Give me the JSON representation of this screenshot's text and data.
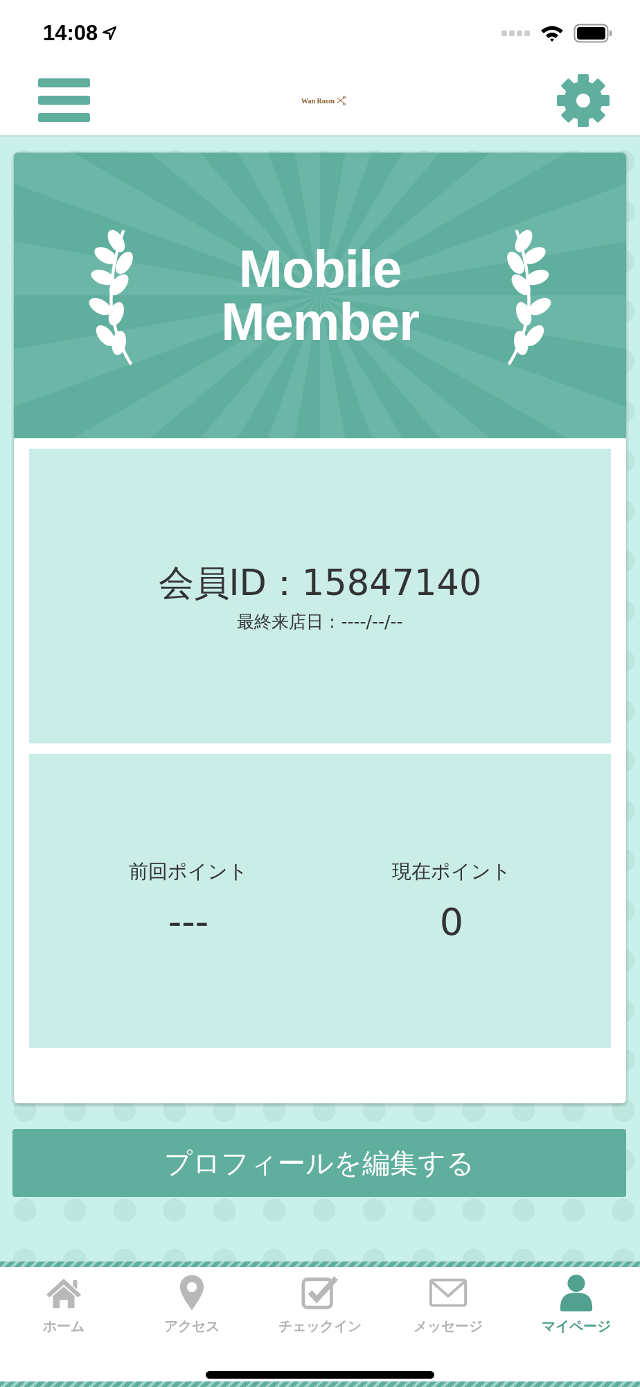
{
  "status_bar": {
    "time": "14:08"
  },
  "header": {
    "logo": "Wan Room"
  },
  "banner": {
    "title_line_1": "Mobile",
    "title_line_2": "Member"
  },
  "member": {
    "id_label": "会員ID：15847140",
    "last_visit": "最終来店日：----/--/--"
  },
  "points": [
    {
      "label": "前回ポイント",
      "value": "---"
    },
    {
      "label": "現在ポイント",
      "value": "0"
    }
  ],
  "edit_button": "プロフィールを編集する",
  "tabs": [
    {
      "label": "ホーム",
      "kind": "home",
      "selected": false
    },
    {
      "label": "アクセス",
      "kind": "access",
      "selected": false
    },
    {
      "label": "チェックイン",
      "kind": "checkin",
      "selected": false
    },
    {
      "label": "メッセージ",
      "kind": "message",
      "selected": false
    },
    {
      "label": "マイページ",
      "kind": "mypage",
      "selected": true
    }
  ]
}
